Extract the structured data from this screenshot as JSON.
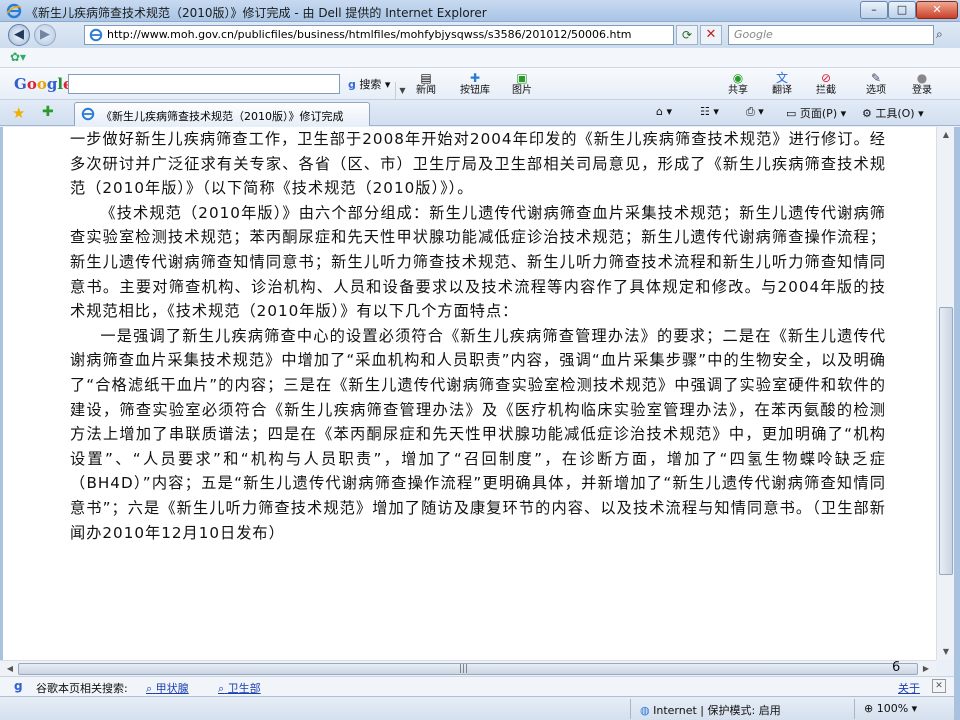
{
  "window": {
    "title": "《新生儿疾病筛查技术规范（2010版）》修订完成 - 由 Dell 提供的 Internet Explorer",
    "minimize": "–",
    "maximize": "□",
    "close": "✕"
  },
  "address": {
    "url": "http://www.moh.gov.cn/publicfiles/business/htmlfiles/mohfybjysqwss/s3586/201012/50006.htm",
    "search_placeholder": "Google"
  },
  "google_toolbar": {
    "logo": [
      "G",
      "o",
      "o",
      "g",
      "l",
      "e"
    ],
    "search_btn": "搜索",
    "news": "新闻",
    "buttons_lib": "按钮库",
    "images": "图片",
    "share": "共享",
    "translate": "翻译",
    "block": "拦截",
    "options": "选项",
    "login": "登录"
  },
  "tab": {
    "label": "《新生儿疾病筛查技术规范（2010版）》修订完成"
  },
  "command_bar": {
    "page": "页面(P)",
    "tools": "工具(O)"
  },
  "document": {
    "paragraphs": [
      "一步做好新生儿疾病筛查工作，卫生部于2008年开始对2004年印发的《新生儿疾病筛查技术规范》进行修订。经多次研讨并广泛征求有关专家、各省（区、市）卫生厅局及卫生部相关司局意见，形成了《新生儿疾病筛查技术规范（2010年版）》（以下简称《技术规范（2010版）》）。",
      "《技术规范（2010年版）》由六个部分组成：新生儿遗传代谢病筛查血片采集技术规范；新生儿遗传代谢病筛查实验室检测技术规范；苯丙酮尿症和先天性甲状腺功能减低症诊治技术规范；新生儿遗传代谢病筛查操作流程；新生儿遗传代谢病筛查知情同意书；新生儿听力筛查技术规范、新生儿听力筛查技术流程和新生儿听力筛查知情同意书。主要对筛查机构、诊治机构、人员和设备要求以及技术流程等内容作了具体规定和修改。与2004年版的技术规范相比，《技术规范（2010年版）》有以下几个方面特点：",
      "一是强调了新生儿疾病筛查中心的设置必须符合《新生儿疾病筛查管理办法》的要求；二是在《新生儿遗传代谢病筛查血片采集技术规范》中增加了“采血机构和人员职责”内容，强调“血片采集步骤”中的生物安全，以及明确了“合格滤纸干血片”的内容；三是在《新生儿遗传代谢病筛查实验室检测技术规范》中强调了实验室硬件和软件的建设，筛查实验室必须符合《新生儿疾病筛查管理办法》及《医疗机构临床实验室管理办法》，在苯丙氨酸的检测方法上增加了串联质谱法；四是在《苯丙酮尿症和先天性甲状腺功能减低症诊治技术规范》中，更加明确了“机构设置”、“人员要求”和“机构与人员职责”，增加了“召回制度”，在诊断方面，增加了“四氢生物蝶呤缺乏症（BH4D）”内容；五是“新生儿遗传代谢病筛查操作流程”更明确具体，并新增加了“新生儿遗传代谢病筛查知情同意书”；六是《新生儿听力筛查技术规范》增加了随访及康复环节的内容、以及技术流程与知情同意书。（卫生部新闻办2010年12月10日发布）"
    ],
    "page_number": "6"
  },
  "related_search": {
    "label": "谷歌本页相关搜索:",
    "links": [
      "甲状腺",
      "卫生部"
    ],
    "close_text": "关于"
  },
  "status": {
    "zone": "Internet | 保护模式: 启用",
    "zoom": "100%"
  }
}
